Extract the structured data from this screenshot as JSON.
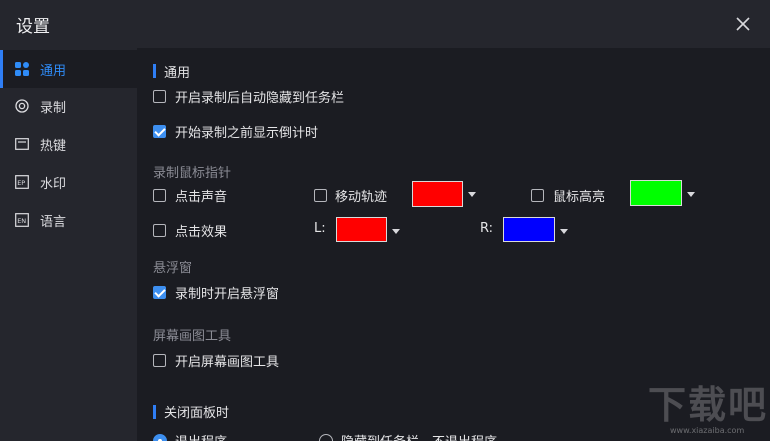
{
  "window": {
    "title": "设置"
  },
  "sidebar": {
    "items": [
      {
        "label": "通用",
        "icon": "grid-icon",
        "active": true
      },
      {
        "label": "录制",
        "icon": "record-icon",
        "active": false
      },
      {
        "label": "热键",
        "icon": "keyboard-icon",
        "active": false
      },
      {
        "label": "水印",
        "icon": "watermark-icon",
        "active": false
      },
      {
        "label": "语言",
        "icon": "language-icon",
        "active": false
      }
    ]
  },
  "general": {
    "title": "通用",
    "auto_hide_label": "开启录制后自动隐藏到任务栏",
    "auto_hide_checked": false,
    "countdown_label": "开始录制之前显示倒计时",
    "countdown_checked": true
  },
  "mouse": {
    "title": "录制鼠标指针",
    "click_sound_label": "点击声音",
    "move_track_label": "移动轨迹",
    "move_track_color": "#ff0000",
    "highlight_label": "鼠标高亮",
    "highlight_color": "#00ff00",
    "click_effect_label": "点击效果",
    "left_label": "L:",
    "left_color": "#ff0000",
    "right_label": "R:",
    "right_color": "#0000ff"
  },
  "floating": {
    "title": "悬浮窗",
    "enable_label": "录制时开启悬浮窗",
    "enable_checked": true
  },
  "drawing": {
    "title": "屏幕画图工具",
    "enable_label": "开启屏幕画图工具",
    "enable_checked": false
  },
  "close_panel": {
    "title": "关闭面板时",
    "option_exit": "退出程序",
    "option_tray": "隐藏到任务栏，不退出程序"
  },
  "watermark": {
    "text": "下载吧",
    "url": "www.xiazaiba.com"
  },
  "colors": {
    "accent": "#2f7ef5",
    "background": "#1b1c22",
    "panel": "#25262d"
  }
}
